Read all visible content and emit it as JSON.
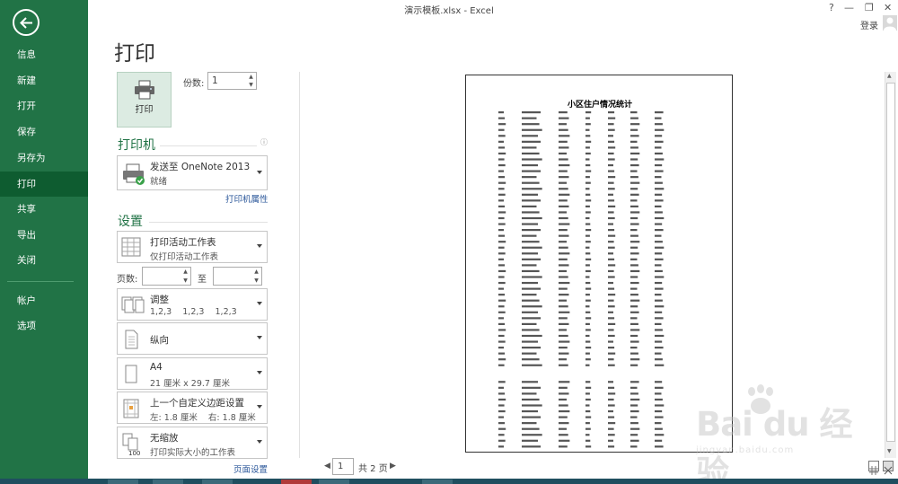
{
  "window": {
    "title": "演示模板.xlsx - Excel",
    "help": "?",
    "minimize": "—",
    "restore": "❐",
    "close": "✕",
    "login": "登录"
  },
  "sidebar": {
    "items": [
      {
        "label": "信息"
      },
      {
        "label": "新建"
      },
      {
        "label": "打开"
      },
      {
        "label": "保存"
      },
      {
        "label": "另存为"
      },
      {
        "label": "打印",
        "active": true
      },
      {
        "label": "共享"
      },
      {
        "label": "导出"
      },
      {
        "label": "关闭"
      },
      {
        "label": "帐户"
      },
      {
        "label": "选项"
      }
    ]
  },
  "print": {
    "page_title": "打印",
    "print_button": "打印",
    "copies_label": "份数:",
    "copies_value": "1",
    "printer_heading": "打印机",
    "printer_name": "发送至 OneNote 2013",
    "printer_status": "就绪",
    "printer_properties": "打印机属性",
    "settings_heading": "设置",
    "settings": [
      {
        "title": "打印活动工作表",
        "sub": "仅打印活动工作表"
      },
      {
        "title": "调整",
        "sub": "1,2,3    1,2,3    1,2,3"
      },
      {
        "title": "纵向",
        "sub": ""
      },
      {
        "title": "A4",
        "sub": "21 厘米 x 29.7 厘米"
      },
      {
        "title": "上一个自定义边距设置",
        "sub": "左: 1.8 厘米    右: 1.8 厘米"
      },
      {
        "title": "无缩放",
        "sub": "打印实际大小的工作表"
      }
    ],
    "pages_label": "页数:",
    "to_label": "至",
    "page_setup": "页面设置"
  },
  "preview": {
    "doc_title": "小区住户情况统计",
    "current_page": "1",
    "total_pages": "共 2 页",
    "prev": "◀",
    "next": "▶"
  },
  "watermark": {
    "brand": "Bai du 经验",
    "url": "jingyan.baidu.com"
  },
  "colors": {
    "accent": "#217346",
    "link": "#2b579a"
  }
}
